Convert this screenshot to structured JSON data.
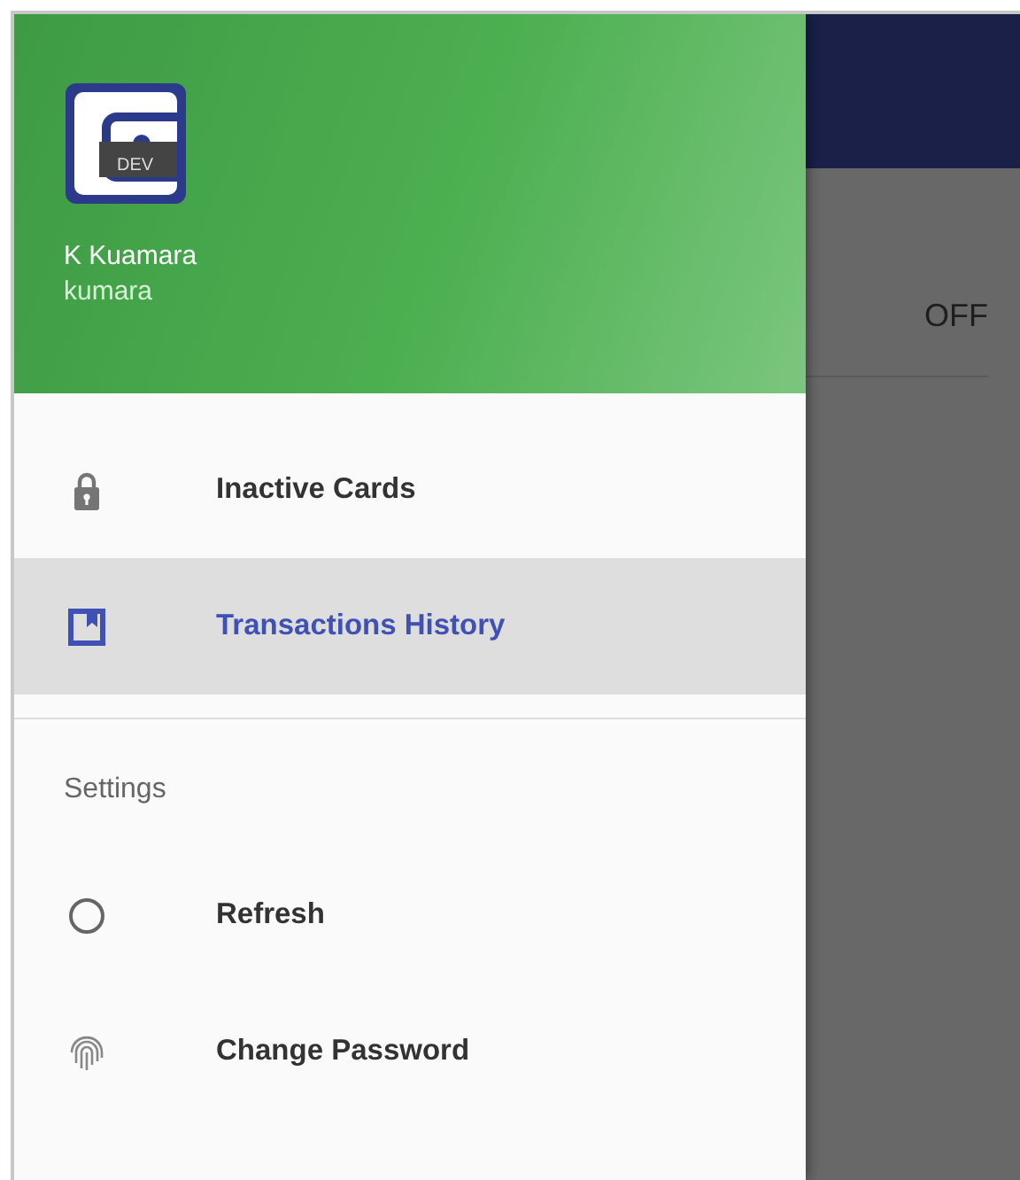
{
  "header": {
    "app_badge": "DEV",
    "name": "K Kuamara",
    "username": "kumara"
  },
  "menu": [
    {
      "label": "Inactive Cards",
      "selected": false
    },
    {
      "label": "Transactions History",
      "selected": true
    }
  ],
  "settings": {
    "title": "Settings",
    "items": [
      {
        "label": "Refresh"
      },
      {
        "label": "Change Password"
      }
    ]
  },
  "background": {
    "toggle_text": "OFF"
  }
}
